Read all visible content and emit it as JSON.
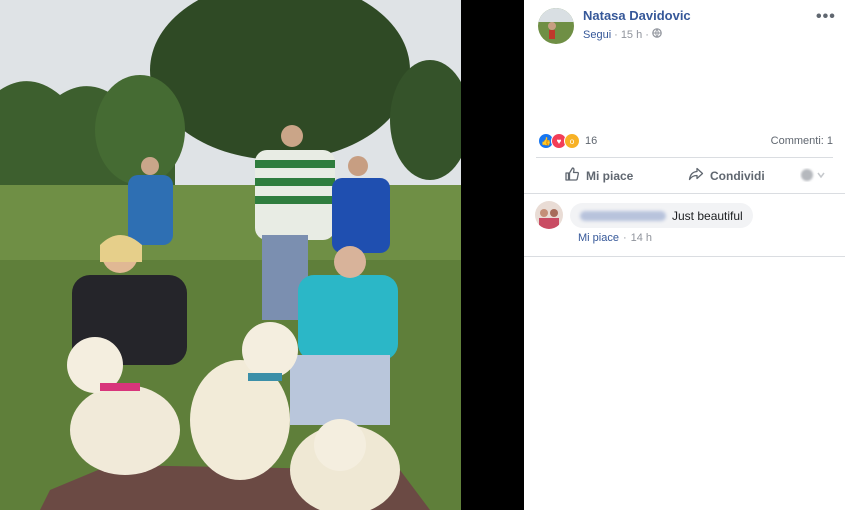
{
  "post": {
    "author": "Natasa Davidovic",
    "follow_label": "Segui",
    "separator": "·",
    "time": "15 h",
    "more_glyph": "•••"
  },
  "reactions": {
    "count": "16",
    "comments_label": "Commenti: 1",
    "types": [
      "like",
      "love",
      "wow"
    ]
  },
  "actions": {
    "like_label": "Mi piace",
    "share_label": "Condividi"
  },
  "comment": {
    "text": "Just beautiful",
    "like_label": "Mi piace",
    "separator": "·",
    "time": "14 h"
  },
  "colors": {
    "link_blue": "#365899",
    "meta_gray": "#90949c",
    "like_blue": "#1877f2",
    "love_red": "#f33e58",
    "wow_yellow": "#f7b125"
  }
}
